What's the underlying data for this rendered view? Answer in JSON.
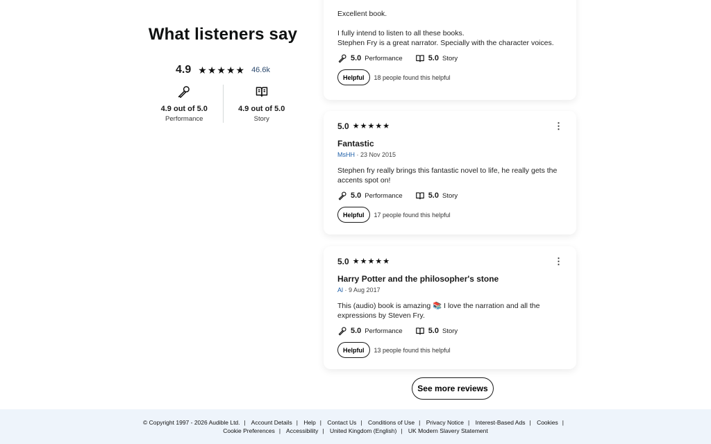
{
  "summary": {
    "heading": "What listeners say",
    "overall_score": "4.9",
    "rating_count": "46.6k",
    "performance": {
      "value": "4.9 out of 5.0",
      "label": "Performance",
      "icon": "microphone-icon"
    },
    "story": {
      "value": "4.9 out of 5.0",
      "label": "Story",
      "icon": "book-icon"
    }
  },
  "reviews": [
    {
      "body_lines": [
        "Excellent book.",
        "I fully intend to listen to all these books.",
        "Stephen Fry is a great narrator. Specially with the character voices."
      ],
      "performance_score": "5.0",
      "performance_label": "Performance",
      "story_score": "5.0",
      "story_label": "Story",
      "helpful_label": "Helpful",
      "helpful_count": "18 people found this helpful"
    },
    {
      "rating": "5.0",
      "stars": 5,
      "title": "Fantastic",
      "author": "MsHH",
      "date": "· 23 Nov 2015",
      "body_lines": [
        "Stephen fry really brings this fantastic novel to life, he really gets the",
        "accents spot on!"
      ],
      "performance_score": "5.0",
      "performance_label": "Performance",
      "story_score": "5.0",
      "story_label": "Story",
      "helpful_label": "Helpful",
      "helpful_count": "17 people found this helpful"
    },
    {
      "rating": "5.0",
      "stars": 5,
      "title": "Harry Potter and the philosopher's stone",
      "author": "Al",
      "date": "· 9 Aug 2017",
      "body_lines": [
        "This (audio) book is amazing 📚 I love the narration and all the",
        "expressions by Steven Fry."
      ],
      "performance_score": "5.0",
      "performance_label": "Performance",
      "story_score": "5.0",
      "story_label": "Story",
      "helpful_label": "Helpful",
      "helpful_count": "13 people found this helpful"
    }
  ],
  "see_more_label": "See more reviews",
  "footer": {
    "row1": [
      "© Copyright 1997 - 2026 Audible Ltd.",
      "Account Details",
      "Help",
      "Contact Us",
      "Conditions of Use",
      "Privacy Notice",
      "Interest-Based Ads",
      "Cookies"
    ],
    "row2": [
      "Cookie Preferences",
      "Accessibility",
      "United Kingdom (English)",
      "UK Modern Slavery Statement"
    ]
  },
  "colors": {
    "author_link": "#1d5fa8",
    "footer_bg": "#eef4fb"
  }
}
